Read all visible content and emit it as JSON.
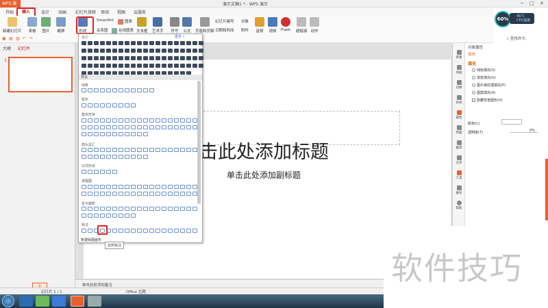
{
  "window": {
    "app_name": "WPS 演示",
    "document_title": "演示文稿1 * - WPS 演示"
  },
  "tabs": [
    {
      "label": "开始"
    },
    {
      "label": "插入"
    },
    {
      "label": "设计"
    },
    {
      "label": "动画"
    },
    {
      "label": "幻灯片放映"
    },
    {
      "label": "审阅"
    },
    {
      "label": "视图"
    },
    {
      "label": "云服务"
    }
  ],
  "ribbon": {
    "new_slide": "新建幻灯片",
    "table": "表格",
    "picture": "图片",
    "screenshot": "截屏",
    "shapes": "形状",
    "smartart": "SmartArt",
    "chart": "图表",
    "relation_chart": "关系图",
    "online_chart": "在线图表",
    "textbox": "文本框",
    "wordart": "艺术字",
    "symbol": "符号",
    "formula": "公式",
    "header_footer": "页眉和页脚",
    "slide_number": "幻灯片编号",
    "object": "对象",
    "datetime": "日期和时间",
    "attachment": "附件",
    "audio": "音频",
    "video": "视频",
    "flash": "Flash",
    "hyperlink": "超链接",
    "action": "动作"
  },
  "performance": {
    "percent": "60%",
    "temp": "46℃",
    "cpu_label": "CPU温度"
  },
  "search": {
    "placeholder": "查找命令、"
  },
  "left_panel": {
    "tab_outline": "大纲",
    "tab_slides": "幻灯片",
    "slide_number": "1"
  },
  "slide": {
    "title_placeholder": "单击此处添加标题",
    "title_visible": "击此处添加标题",
    "subtitle_placeholder": "单击此处添加副标题"
  },
  "shapes_panel": {
    "recent_label": "最近",
    "more_link": "更多 »",
    "header_preset": "预设",
    "categories": {
      "lines": "线条",
      "rectangles": "矩形",
      "basic": "基本形状",
      "arrows": "箭头总汇",
      "formula": "公式形状",
      "flowchart": "流程图",
      "stars": "星与旗帜",
      "callouts": "标注"
    },
    "tooltip": "云形标注",
    "new_canvas": "新建绘图画布"
  },
  "right_panel": {
    "title": "对象属性",
    "fill_tab": "填充",
    "section": "填充",
    "options": [
      {
        "label": "纯色填充(S)"
      },
      {
        "label": "渐变填充(G)"
      },
      {
        "label": "图片或纹理填充(P)"
      },
      {
        "label": "图案填充(A)"
      },
      {
        "label": "隐藏背景图形(H)"
      }
    ],
    "color_label": "颜色(C)",
    "transparency_label": "透明度(T)",
    "transparency_value": "0%",
    "sidebar": [
      {
        "label": "新建"
      },
      {
        "label": "动画"
      },
      {
        "label": "切换"
      },
      {
        "label": "形状"
      },
      {
        "label": "属性"
      },
      {
        "label": "传图"
      },
      {
        "label": "推荐"
      },
      {
        "label": "分享"
      },
      {
        "label": "工具"
      },
      {
        "label": "备份"
      },
      {
        "label": "帮助"
      }
    ]
  },
  "notes": {
    "placeholder": "单击此处添加备注"
  },
  "status": {
    "slide_info": "幻灯片 1 / 1",
    "theme": "Office 主题"
  },
  "watermark": {
    "text": "软件技巧"
  },
  "colors": {
    "accent": "#e8612c",
    "highlight": "#e02020"
  }
}
